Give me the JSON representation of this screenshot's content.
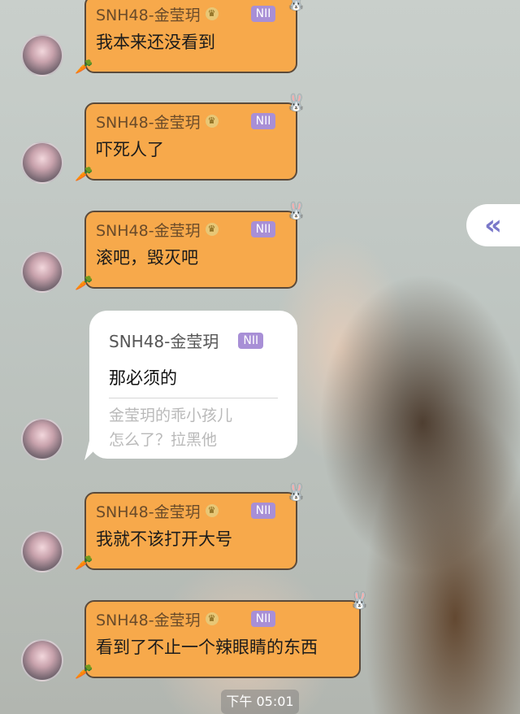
{
  "messages": [
    {
      "sender": "SNH48-金莹玥",
      "badge": "NII",
      "text": "我本来还没看到"
    },
    {
      "sender": "SNH48-金莹玥",
      "badge": "NII",
      "text": "吓死人了"
    },
    {
      "sender": "SNH48-金莹玥",
      "badge": "NII",
      "text": "滚吧，毁灭吧"
    },
    {
      "sender": "SNH48-金莹玥",
      "badge": "NII",
      "text": "我就不该打开大号"
    },
    {
      "sender": "SNH48-金莹玥",
      "badge": "NII",
      "text": "看到了不止一个辣眼睛的东西"
    }
  ],
  "reply_bubble": {
    "sender": "SNH48-金莹玥",
    "badge": "NII",
    "text": "那必须的",
    "quote_user": "金莹玥的乖小孩儿",
    "quote_text": "怎么了？拉黑他"
  },
  "side_button": {
    "icon": "double-chevron-left-icon",
    "glyph": "«"
  },
  "timestamp": "下午 05:01",
  "colors": {
    "bubble": "#f7a94b",
    "badge": "#a88fd6",
    "accent": "#7a78c9"
  }
}
